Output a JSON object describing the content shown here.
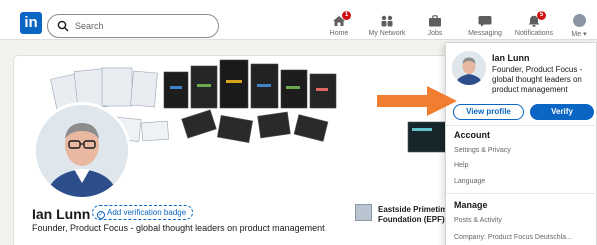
{
  "nav": {
    "logo_text": "in",
    "search_placeholder": "Search",
    "items": [
      {
        "label": "Home",
        "icon": "home-icon",
        "badge": "1"
      },
      {
        "label": "My Network",
        "icon": "network-icon",
        "badge": ""
      },
      {
        "label": "Jobs",
        "icon": "briefcase-icon",
        "badge": ""
      },
      {
        "label": "Messaging",
        "icon": "messaging-icon",
        "badge": ""
      },
      {
        "label": "Notifications",
        "icon": "bell-icon",
        "badge": "5"
      },
      {
        "label": "Me ▾",
        "icon": "avatar-icon",
        "badge": ""
      }
    ]
  },
  "profile": {
    "name": "Ian Lunn",
    "verify_badge": "Add verification badge",
    "headline": "Founder, Product Focus - global thought leaders on product management",
    "org_name_line1": "Eastside Primetim",
    "org_name_line2": "Foundation (EPF)"
  },
  "dropdown": {
    "name": "Ian Lunn",
    "headline": "Founder, Product Focus - global thought leaders on product management",
    "view_profile": "View profile",
    "verify": "Verify",
    "account_title": "Account",
    "account_links": [
      "Settings & Privacy",
      "Help",
      "Language"
    ],
    "manage_title": "Manage",
    "manage_links": [
      "Posts & Activity",
      "Company: Product Focus Deutschla..."
    ]
  },
  "colors": {
    "brand": "#0a66c2",
    "arrow": "#f07d30",
    "badge": "#cc1016"
  }
}
